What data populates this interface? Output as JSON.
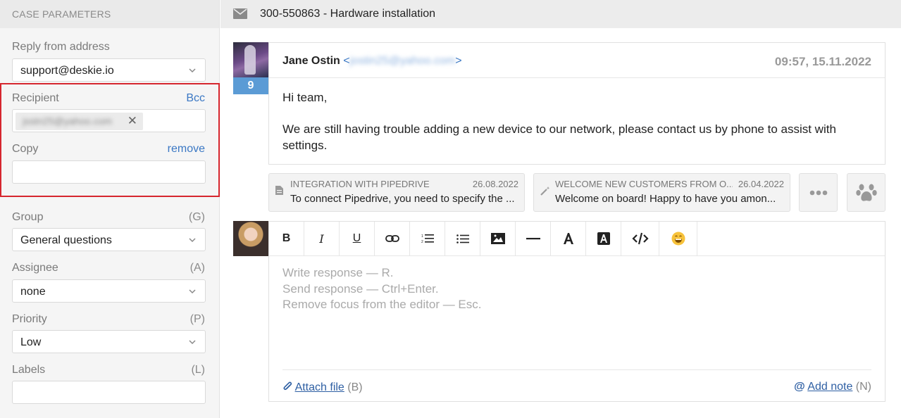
{
  "sidebar": {
    "header": "CASE PARAMETERS",
    "reply_from": {
      "label": "Reply from address",
      "value": "support@deskie.io"
    },
    "recipient": {
      "label": "Recipient",
      "bcc": "Bcc",
      "chip": "jsstn25@yahoo.com"
    },
    "copy": {
      "label": "Copy",
      "remove": "remove"
    },
    "group": {
      "label": "Group",
      "hint": "(G)",
      "value": "General questions"
    },
    "assignee": {
      "label": "Assignee",
      "hint": "(A)",
      "value": "none"
    },
    "priority": {
      "label": "Priority",
      "hint": "(P)",
      "value": "Low"
    },
    "labels": {
      "label": "Labels",
      "hint": "(L)"
    }
  },
  "case": {
    "title": "300-550863 - Hardware installation"
  },
  "message": {
    "badge": "9",
    "sender": "Jane Ostin",
    "email_open": "<",
    "email": "jostin25@yahoo.com",
    "email_close": ">",
    "time": "09:57, 15.11.2022",
    "line1": "Hi team,",
    "line2": "We are still having trouble adding a new device to our network, please contact us by phone to assist with settings."
  },
  "templates": [
    {
      "title": "INTEGRATION WITH PIPEDRIVE",
      "date": "26.08.2022",
      "text": "To connect Pipedrive, you need to specify the ..."
    },
    {
      "title": "WELCOME NEW CUSTOMERS FROM O...",
      "date": "26.04.2022",
      "text": "Welcome on board! Happy to have you amon..."
    }
  ],
  "toolbar": {
    "bold": "B",
    "italic": "I",
    "underline": "U"
  },
  "editor": {
    "ph1": "Write response — R.",
    "ph2": "Send response — Ctrl+Enter.",
    "ph3": "Remove focus from the editor — Esc.",
    "attach": "Attach file",
    "attach_hint": " (B)",
    "note": "Add note",
    "note_hint": " (N)"
  },
  "colors": {
    "accent": "#3b78c4",
    "highlight": "#d6262e",
    "badge": "#5b9bd5"
  }
}
